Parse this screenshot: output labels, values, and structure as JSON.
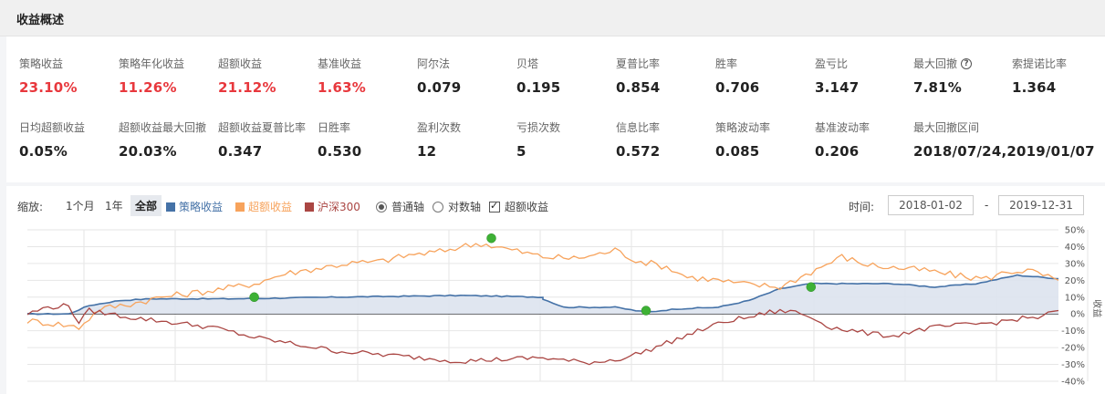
{
  "header": {
    "title": "收益概述"
  },
  "stats_row1": [
    {
      "label": "策略收益",
      "value": "23.10%",
      "highlight": true
    },
    {
      "label": "策略年化收益",
      "value": "11.26%",
      "highlight": true
    },
    {
      "label": "超额收益",
      "value": "21.12%",
      "highlight": true
    },
    {
      "label": "基准收益",
      "value": "1.63%",
      "highlight": true
    },
    {
      "label": "阿尔法",
      "value": "0.079",
      "highlight": false
    },
    {
      "label": "贝塔",
      "value": "0.195",
      "highlight": false
    },
    {
      "label": "夏普比率",
      "value": "0.854",
      "highlight": false
    },
    {
      "label": "胜率",
      "value": "0.706",
      "highlight": false
    },
    {
      "label": "盈亏比",
      "value": "3.147",
      "highlight": false
    },
    {
      "label": "最大回撤",
      "value": "7.81%",
      "highlight": false,
      "help_icon": "question-circle-icon"
    },
    {
      "label": "索提诺比率",
      "value": "1.364",
      "highlight": false
    }
  ],
  "stats_row2": [
    {
      "label": "日均超额收益",
      "value": "0.05%"
    },
    {
      "label": "超额收益最大回撤",
      "value": "20.03%"
    },
    {
      "label": "超额收益夏普比率",
      "value": "0.347"
    },
    {
      "label": "日胜率",
      "value": "0.530"
    },
    {
      "label": "盈利次数",
      "value": "12"
    },
    {
      "label": "亏损次数",
      "value": "5"
    },
    {
      "label": "信息比率",
      "value": "0.572"
    },
    {
      "label": "策略波动率",
      "value": "0.085"
    },
    {
      "label": "基准波动率",
      "value": "0.206"
    },
    {
      "label": "最大回撤区间",
      "value": "2018/07/24,2019/01/07"
    }
  ],
  "toolbar": {
    "zoom_label": "缩放:",
    "zoom_options": [
      "1个月",
      "1年",
      "全部"
    ],
    "zoom_selected": "全部",
    "legend": [
      {
        "name": "策略收益",
        "color": "#4572a7"
      },
      {
        "name": "超额收益",
        "color": "#f7a35c"
      },
      {
        "name": "沪深300",
        "color": "#aa4643"
      }
    ],
    "axis_mode": [
      {
        "label": "普通轴",
        "selected": true
      },
      {
        "label": "对数轴",
        "selected": false
      }
    ],
    "excess_checkbox": {
      "label": "超额收益",
      "checked": true
    },
    "time_label": "时间:",
    "start_date": "2018-01-02",
    "date_sep": "-",
    "end_date": "2019-12-31"
  },
  "chart_data": {
    "type": "line",
    "x_range": [
      "2018-01-02",
      "2019-12-31"
    ],
    "ylim": [
      -40,
      50
    ],
    "y_ticks": [
      50,
      40,
      30,
      20,
      10,
      0,
      -10,
      -20,
      -30,
      -40
    ],
    "y_tick_suffix": "%",
    "ylabel": "收益",
    "grid": true,
    "series": [
      {
        "name": "策略收益",
        "color": "#4572a7",
        "fill": true,
        "points": [
          [
            0,
            0
          ],
          [
            0.04,
            0
          ],
          [
            0.06,
            5
          ],
          [
            0.09,
            8
          ],
          [
            0.12,
            9
          ],
          [
            0.2,
            9
          ],
          [
            0.3,
            10
          ],
          [
            0.42,
            11
          ],
          [
            0.5,
            10
          ],
          [
            0.5,
            9
          ],
          [
            0.52,
            4
          ],
          [
            0.54,
            4
          ],
          [
            0.57,
            4
          ],
          [
            0.6,
            1
          ],
          [
            0.63,
            3
          ],
          [
            0.67,
            4
          ],
          [
            0.7,
            8
          ],
          [
            0.73,
            15
          ],
          [
            0.76,
            18
          ],
          [
            0.8,
            18
          ],
          [
            0.84,
            18
          ],
          [
            0.88,
            16
          ],
          [
            0.92,
            18
          ],
          [
            0.96,
            23
          ],
          [
            1,
            21
          ]
        ]
      },
      {
        "name": "超额收益",
        "color": "#f7a35c",
        "fill": false,
        "points": [
          [
            0,
            -4
          ],
          [
            0.03,
            -6
          ],
          [
            0.05,
            -8
          ],
          [
            0.07,
            3
          ],
          [
            0.1,
            6
          ],
          [
            0.13,
            10
          ],
          [
            0.18,
            14
          ],
          [
            0.22,
            18
          ],
          [
            0.25,
            24
          ],
          [
            0.28,
            27
          ],
          [
            0.31,
            30
          ],
          [
            0.34,
            31
          ],
          [
            0.37,
            35
          ],
          [
            0.4,
            37
          ],
          [
            0.42,
            40
          ],
          [
            0.44,
            42
          ],
          [
            0.47,
            38
          ],
          [
            0.5,
            34
          ],
          [
            0.53,
            33
          ],
          [
            0.55,
            35
          ],
          [
            0.57,
            38
          ],
          [
            0.59,
            32
          ],
          [
            0.62,
            28
          ],
          [
            0.64,
            22
          ],
          [
            0.67,
            20
          ],
          [
            0.69,
            18
          ],
          [
            0.71,
            17
          ],
          [
            0.73,
            16
          ],
          [
            0.75,
            22
          ],
          [
            0.77,
            28
          ],
          [
            0.79,
            34
          ],
          [
            0.81,
            30
          ],
          [
            0.83,
            28
          ],
          [
            0.85,
            27
          ],
          [
            0.87,
            26
          ],
          [
            0.89,
            24
          ],
          [
            0.91,
            22
          ],
          [
            0.93,
            21
          ],
          [
            0.95,
            25
          ],
          [
            0.97,
            26
          ],
          [
            1,
            20
          ]
        ]
      },
      {
        "name": "沪深300",
        "color": "#aa4643",
        "fill": false,
        "points": [
          [
            0,
            0
          ],
          [
            0.02,
            4
          ],
          [
            0.04,
            5
          ],
          [
            0.05,
            -5
          ],
          [
            0.06,
            2
          ],
          [
            0.08,
            0
          ],
          [
            0.1,
            -2
          ],
          [
            0.14,
            -5
          ],
          [
            0.18,
            -8
          ],
          [
            0.22,
            -14
          ],
          [
            0.26,
            -18
          ],
          [
            0.3,
            -22
          ],
          [
            0.34,
            -24
          ],
          [
            0.38,
            -26
          ],
          [
            0.42,
            -28
          ],
          [
            0.46,
            -27
          ],
          [
            0.5,
            -26
          ],
          [
            0.54,
            -29
          ],
          [
            0.56,
            -28
          ],
          [
            0.58,
            -26
          ],
          [
            0.6,
            -22
          ],
          [
            0.63,
            -15
          ],
          [
            0.66,
            -8
          ],
          [
            0.68,
            -4
          ],
          [
            0.7,
            -2
          ],
          [
            0.72,
            1
          ],
          [
            0.74,
            2
          ],
          [
            0.76,
            -2
          ],
          [
            0.78,
            -8
          ],
          [
            0.8,
            -10
          ],
          [
            0.82,
            -12
          ],
          [
            0.84,
            -13
          ],
          [
            0.86,
            -10
          ],
          [
            0.88,
            -8
          ],
          [
            0.9,
            -7
          ],
          [
            0.92,
            -6
          ],
          [
            0.94,
            -5
          ],
          [
            0.96,
            -3
          ],
          [
            0.98,
            -2
          ],
          [
            1,
            2
          ]
        ]
      }
    ],
    "markers": [
      {
        "x": 0.22,
        "y": 10,
        "color": "#3eb135"
      },
      {
        "x": 0.45,
        "y": 45,
        "color": "#3eb135"
      },
      {
        "x": 0.6,
        "y": 2,
        "color": "#3eb135"
      },
      {
        "x": 0.76,
        "y": 16,
        "color": "#3eb135"
      }
    ]
  }
}
